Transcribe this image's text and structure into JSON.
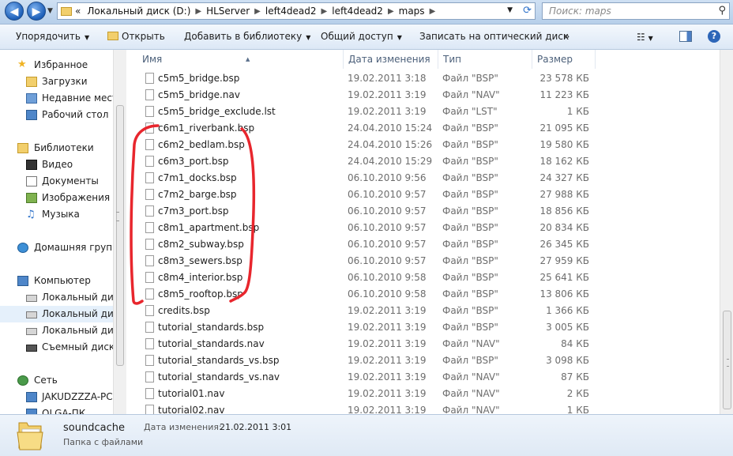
{
  "address": {
    "back_icon": "arrow-left-icon",
    "forward_icon": "arrow-right-icon",
    "prefix": "«",
    "crumbs": [
      "Локальный диск (D:)",
      "HLServer",
      "left4dead2",
      "left4dead2",
      "maps"
    ],
    "search_placeholder": "Поиск: maps"
  },
  "toolbar": {
    "organize": "Упорядочить",
    "open": "Открыть",
    "add_library": "Добавить в библиотеку",
    "share": "Общий доступ",
    "burn": "Записать на оптический диск",
    "more": "»",
    "help": "?"
  },
  "sidebar": {
    "items": [
      {
        "label": "Избранное",
        "icon": "star-icon"
      },
      {
        "label": "Загрузки",
        "icon": "downloads-folder-icon"
      },
      {
        "label": "Недавние места",
        "icon": "recent-places-icon"
      },
      {
        "label": "Рабочий стол",
        "icon": "desktop-icon"
      },
      {
        "label": "Библиотеки",
        "icon": "libraries-icon"
      },
      {
        "label": "Видео",
        "icon": "video-icon"
      },
      {
        "label": "Документы",
        "icon": "documents-icon"
      },
      {
        "label": "Изображения",
        "icon": "pictures-icon"
      },
      {
        "label": "Музыка",
        "icon": "music-icon"
      },
      {
        "label": "Домашняя группа",
        "icon": "homegroup-icon"
      },
      {
        "label": "Компьютер",
        "icon": "computer-icon"
      },
      {
        "label": "Локальный диск",
        "icon": "local-disk-c-icon"
      },
      {
        "label": "Локальный диск",
        "icon": "local-disk-d-icon"
      },
      {
        "label": "Локальный диск",
        "icon": "local-disk-e-icon"
      },
      {
        "label": "Съемный диск (",
        "icon": "removable-disk-icon"
      },
      {
        "label": "Сеть",
        "icon": "network-icon"
      },
      {
        "label": "JAKUDZZZA-PC",
        "icon": "network-pc-icon"
      },
      {
        "label": "OLGA-ПК",
        "icon": "network-pc-icon"
      }
    ]
  },
  "columns": {
    "name": "Имя",
    "date": "Дата изменения",
    "type": "Тип",
    "size": "Размер"
  },
  "files": [
    {
      "name": "c5m5_bridge.bsp",
      "date": "19.02.2011 3:18",
      "type": "Файл \"BSP\"",
      "size": "23 578 КБ"
    },
    {
      "name": "c5m5_bridge.nav",
      "date": "19.02.2011 3:19",
      "type": "Файл \"NAV\"",
      "size": "11 223 КБ"
    },
    {
      "name": "c5m5_bridge_exclude.lst",
      "date": "19.02.2011 3:19",
      "type": "Файл \"LST\"",
      "size": "1 КБ"
    },
    {
      "name": "c6m1_riverbank.bsp",
      "date": "24.04.2010 15:24",
      "type": "Файл \"BSP\"",
      "size": "21 095 КБ"
    },
    {
      "name": "c6m2_bedlam.bsp",
      "date": "24.04.2010 15:26",
      "type": "Файл \"BSP\"",
      "size": "19 580 КБ"
    },
    {
      "name": "c6m3_port.bsp",
      "date": "24.04.2010 15:29",
      "type": "Файл \"BSP\"",
      "size": "18 162 КБ"
    },
    {
      "name": "c7m1_docks.bsp",
      "date": "06.10.2010 9:56",
      "type": "Файл \"BSP\"",
      "size": "24 327 КБ"
    },
    {
      "name": "c7m2_barge.bsp",
      "date": "06.10.2010 9:57",
      "type": "Файл \"BSP\"",
      "size": "27 988 КБ"
    },
    {
      "name": "c7m3_port.bsp",
      "date": "06.10.2010 9:57",
      "type": "Файл \"BSP\"",
      "size": "18 856 КБ"
    },
    {
      "name": "c8m1_apartment.bsp",
      "date": "06.10.2010 9:57",
      "type": "Файл \"BSP\"",
      "size": "20 834 КБ"
    },
    {
      "name": "c8m2_subway.bsp",
      "date": "06.10.2010 9:57",
      "type": "Файл \"BSP\"",
      "size": "26 345 КБ"
    },
    {
      "name": "c8m3_sewers.bsp",
      "date": "06.10.2010 9:57",
      "type": "Файл \"BSP\"",
      "size": "27 959 КБ"
    },
    {
      "name": "c8m4_interior.bsp",
      "date": "06.10.2010 9:58",
      "type": "Файл \"BSP\"",
      "size": "25 641 КБ"
    },
    {
      "name": "c8m5_rooftop.bsp",
      "date": "06.10.2010 9:58",
      "type": "Файл \"BSP\"",
      "size": "13 806 КБ"
    },
    {
      "name": "credits.bsp",
      "date": "19.02.2011 3:19",
      "type": "Файл \"BSP\"",
      "size": "1 366 КБ"
    },
    {
      "name": "tutorial_standards.bsp",
      "date": "19.02.2011 3:19",
      "type": "Файл \"BSP\"",
      "size": "3 005 КБ"
    },
    {
      "name": "tutorial_standards.nav",
      "date": "19.02.2011 3:19",
      "type": "Файл \"NAV\"",
      "size": "84 КБ"
    },
    {
      "name": "tutorial_standards_vs.bsp",
      "date": "19.02.2011 3:19",
      "type": "Файл \"BSP\"",
      "size": "3 098 КБ"
    },
    {
      "name": "tutorial_standards_vs.nav",
      "date": "19.02.2011 3:19",
      "type": "Файл \"NAV\"",
      "size": "87 КБ"
    },
    {
      "name": "tutorial01.nav",
      "date": "19.02.2011 3:19",
      "type": "Файл \"NAV\"",
      "size": "2 КБ"
    },
    {
      "name": "tutorial02.nav",
      "date": "19.02.2011 3:19",
      "type": "Файл \"NAV\"",
      "size": "1 КБ"
    }
  ],
  "details": {
    "name": "soundcache",
    "kind": "Папка с файлами",
    "modified_label": "Дата изменения:",
    "modified_value": "21.02.2011 3:01"
  },
  "colors": {
    "annotation": "#e8262d",
    "selection": "#e5f0fb"
  }
}
